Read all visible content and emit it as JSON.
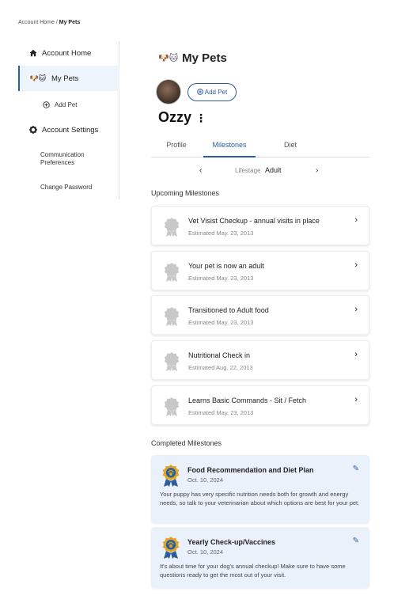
{
  "breadcrumb": {
    "home": "Account Home",
    "separator": " / ",
    "current": "My Pets"
  },
  "sidebar": {
    "items": [
      {
        "label": "Account Home",
        "icon": "home-icon"
      },
      {
        "label": "My Pets",
        "icon": "pets-icon"
      },
      {
        "label": "Add Pet",
        "icon": "add-circle-icon"
      },
      {
        "label": "Account Settings",
        "icon": "gear-icon"
      },
      {
        "label": "Communication Preferences"
      },
      {
        "label": "Change Password"
      }
    ]
  },
  "page": {
    "title": "My Pets",
    "title_icon": "🐶🐱"
  },
  "pet": {
    "name": "Ozzy",
    "add_pet_label": "Add Pet"
  },
  "tabs": [
    {
      "label": "Profile"
    },
    {
      "label": "Milestones"
    },
    {
      "label": "Diet"
    }
  ],
  "lifestage": {
    "label": "Lifestage",
    "value": "Adult",
    "prev": "‹",
    "next": "›"
  },
  "upcoming": {
    "title": "Upcoming Milestones",
    "items": [
      {
        "title": "Vet Visist Checkup - annual visits in place",
        "date": "Estimated May. 23, 2013"
      },
      {
        "title": "Your pet is now an adult",
        "date": "Estimated May. 23, 2013"
      },
      {
        "title": "Transitioned to Adult food",
        "date": "Estimated May. 23, 2013"
      },
      {
        "title": "Nutritional Check in",
        "date": "Estimated Aug. 22, 2013"
      },
      {
        "title": "Learns Basic Commands - Sit / Fetch",
        "date": "Estimated May. 23, 2013"
      }
    ]
  },
  "completed": {
    "title": "Completed Milestones",
    "items": [
      {
        "title": "Food Recommendation and Diet Plan",
        "date": "Oct. 10, 2024",
        "description": "Your puppy has very specific nutrition needs both for growth and energy needs, so talk to your veterinarian about which options are best for your pet."
      },
      {
        "title": "Yearly Check-up/Vaccines",
        "date": "Oct. 10, 2024",
        "description": "It's about time for your dog's annual checkup! Make sure to have some questions ready to get the most out of your visit."
      }
    ]
  },
  "colors": {
    "accent": "#2a5d9c",
    "completed_bg": "#eaf1fb",
    "badge_gray": "#c8c8c8",
    "medal_gold": "#e0a526"
  }
}
